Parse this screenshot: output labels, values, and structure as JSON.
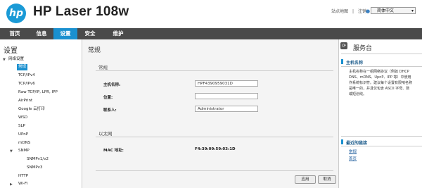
{
  "header": {
    "logo_text": "hp",
    "product_name": "HP Laser 108w",
    "links": [
      "站点地图",
      "注销"
    ],
    "separator": "|",
    "language": "简体中文"
  },
  "nav": {
    "tabs": [
      "首页",
      "信息",
      "设置",
      "安全",
      "维护"
    ],
    "active": "设置"
  },
  "sidebar": {
    "title": "设置",
    "items": [
      "网络设置",
      "常规",
      "TCP/IPv4",
      "TCP/IPv6",
      "Raw TCP/IP, LPR, IPP",
      "AirPrint",
      "Google 云打印",
      "WSD",
      "SLP",
      "UPnP",
      "mDNS",
      "SNMP",
      "SNMPv1/v2",
      "SNMPv3",
      "HTTP",
      "Wi-Fi"
    ]
  },
  "main": {
    "title": "常规",
    "general_section": "常规",
    "host_label": "主机名称:",
    "host_value": "HPF4390959031D",
    "location_label": "位置:",
    "location_value": "",
    "contact_label": "联系人:",
    "contact_value": "Administrator",
    "ethernet_section": "以太网",
    "mac_label": "MAC 地址:",
    "mac_value": "F4:39:09:59:03:1D",
    "apply_label": "应用",
    "cancel_label": "取消"
  },
  "help": {
    "title": "服务台",
    "section1": "主机名称",
    "text_lines": [
      "主机名称在一组网络协议（例如 DHCP",
      "DNS、mDNS、UpnP、IPP 等）中使用",
      "作系统标识符。建议每个设置有限响名称",
      "是唯一的，并且仅包含 ASCII 字母、数",
      "或短划线。"
    ],
    "section2": "最近的链接",
    "links": [
      "常规",
      "首页"
    ]
  },
  "colors": {
    "accent": "#1a90cf",
    "nav_bg": "#4a4a4a",
    "logo": "#1a9ad6"
  }
}
